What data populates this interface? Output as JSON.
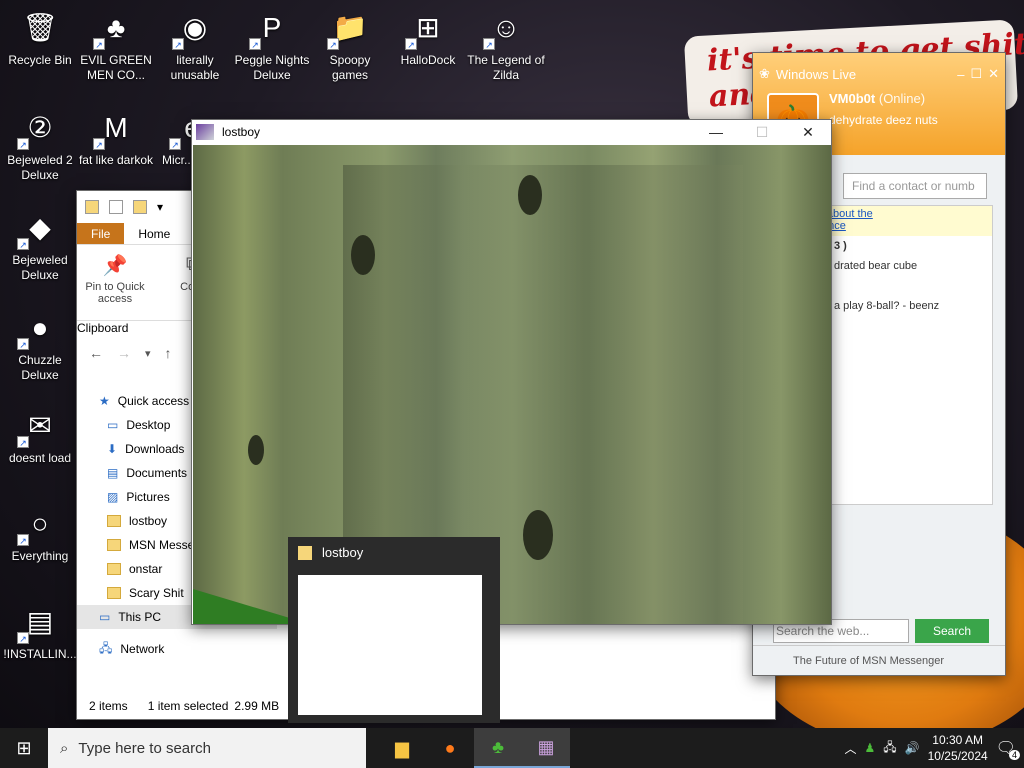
{
  "desktop": {
    "banner_text": "it's time to get shit\nand",
    "icons": [
      {
        "label": "Recycle Bin",
        "icon": "recycle-bin-icon"
      },
      {
        "label": "EVIL GREEN MEN CO...",
        "icon": "msn-buddies-icon"
      },
      {
        "label": "literally unusable",
        "icon": "chrome-icon"
      },
      {
        "label": "Peggle Nights Deluxe",
        "icon": "peggle-icon"
      },
      {
        "label": "Spoopy games",
        "icon": "folder-icon"
      },
      {
        "label": "HalloDock",
        "icon": "windows-logo-icon"
      },
      {
        "label": "The Legend of Zilda",
        "icon": "zelda-icon"
      },
      {
        "label": "Bejeweled 2 Deluxe",
        "icon": "bejeweled2-icon"
      },
      {
        "label": "fat like darkok",
        "icon": "mpl-icon"
      },
      {
        "label": "Micr... Ed...",
        "icon": "edge-icon"
      },
      {
        "label": "Bejeweled Deluxe",
        "icon": "gem-icon"
      },
      {
        "label": "Chuzzle Deluxe",
        "icon": "chuzzle-icon"
      },
      {
        "label": "doesnt load",
        "icon": "thunderbird-icon"
      },
      {
        "label": "Everything",
        "icon": "search-tool-icon"
      },
      {
        "label": "!INSTALLIN...",
        "icon": "text-file-icon"
      }
    ]
  },
  "explorer": {
    "tabs": [
      "File",
      "Home"
    ],
    "ribbon": {
      "pin_label": "Pin to Quick access",
      "copy_label": "Copy",
      "group_label": "Clipboard"
    },
    "sidebar": [
      {
        "label": "Quick access",
        "kind": "star"
      },
      {
        "label": "Desktop",
        "kind": "desktop"
      },
      {
        "label": "Downloads",
        "kind": "download"
      },
      {
        "label": "Documents",
        "kind": "doc"
      },
      {
        "label": "Pictures",
        "kind": "pic"
      },
      {
        "label": "lostboy",
        "kind": "folder"
      },
      {
        "label": "MSN Messe",
        "kind": "folder"
      },
      {
        "label": "onstar",
        "kind": "folder"
      },
      {
        "label": "Scary Shit",
        "kind": "folder"
      },
      {
        "label": "This PC",
        "kind": "pc"
      },
      {
        "label": "Network",
        "kind": "net"
      }
    ],
    "status": {
      "items": "2 items",
      "selected": "1 item selected",
      "size": "2.99 MB"
    }
  },
  "messenger": {
    "title": "Windows Live",
    "user_name": "VM0b0t",
    "user_status": "(Online)",
    "personal_message": "dehydrate deez nuts",
    "search_placeholder": "Find a contact or numb",
    "ad_text": "e to learn about the\ner Experience",
    "contacts": [
      " 3 )",
      "drated bear cube",
      "a play 8-ball? - beenz"
    ],
    "web_search_placeholder": "Search the web...",
    "search_button": "Search",
    "footer": "The Future of MSN Messenger"
  },
  "game": {
    "title": "lostboy",
    "minimize": "—",
    "maximize": "☐",
    "close": "✕"
  },
  "thumbnail": {
    "title": "lostboy"
  },
  "taskbar": {
    "search_placeholder": "Type here to search",
    "time": "10:30 AM",
    "date": "10/25/2024",
    "notification_count": "4"
  }
}
